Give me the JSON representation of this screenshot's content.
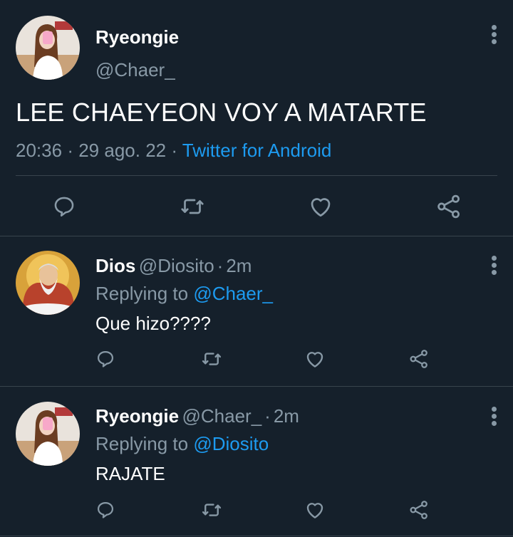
{
  "main_tweet": {
    "author_name": "Ryeongie",
    "author_handle": "@Chaer_",
    "text": "LEE CHAEYEON VOY A MATARTE",
    "time": "20:36",
    "date": "29 ago. 22",
    "source": "Twitter for Android",
    "separator": "·"
  },
  "replies": [
    {
      "author_name": "Dios",
      "author_handle": "@Diosito",
      "age": "2m",
      "replying_prefix": "Replying to",
      "replying_to": "@Chaer_",
      "text": "Que hizo????"
    },
    {
      "author_name": "Ryeongie",
      "author_handle": "@Chaer_",
      "age": "2m",
      "replying_prefix": "Replying to",
      "replying_to": "@Diosito",
      "text": "RAJATE"
    }
  ],
  "colors": {
    "background": "#15202b",
    "muted": "#8899a6",
    "link": "#1d9bf0",
    "divider": "#38444d"
  },
  "icons": {
    "reply": "reply-icon",
    "retweet": "retweet-icon",
    "like": "heart-icon",
    "share": "share-icon",
    "more": "more-vertical-icon"
  }
}
